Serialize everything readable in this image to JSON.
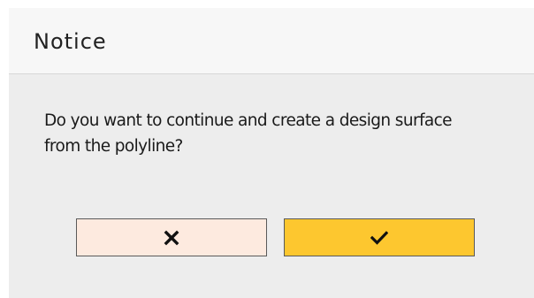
{
  "dialog": {
    "title": "Notice",
    "message": "Do you want to continue and create a design surface from the polyline?",
    "buttons": {
      "cancel_icon": "x-icon",
      "confirm_icon": "checkmark-icon"
    },
    "colors": {
      "cancel_bg": "#fdeadf",
      "confirm_bg": "#fdc72f",
      "header_bg": "#f7f7f7",
      "body_bg": "#ededed"
    }
  }
}
